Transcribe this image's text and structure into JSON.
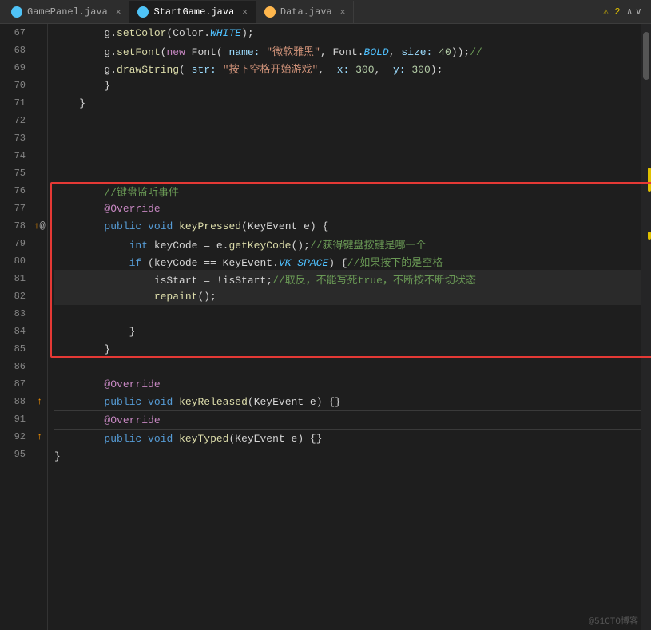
{
  "tabs": [
    {
      "id": "gamepanel",
      "label": "GamePanel.java",
      "active": false,
      "iconColor": "blue"
    },
    {
      "id": "startgame",
      "label": "StartGame.java",
      "active": true,
      "iconColor": "blue"
    },
    {
      "id": "data",
      "label": "Data.java",
      "active": false,
      "iconColor": "orange"
    }
  ],
  "toolbar": {
    "warning_count": "⚠ 2",
    "nav_up": "∧",
    "nav_down": "∨"
  },
  "lines": [
    {
      "num": 67,
      "indent": 2,
      "content": "g.setColor(Color.<span class='const italic'>WHITE</span>);"
    },
    {
      "num": 68,
      "indent": 2,
      "content": "g.setFont(<span class='kw2'>new</span> Font( <span class='param-label'>name:</span> <span class='string'>\"微软雅黑\"</span>, Font.<span class='const italic'>BOLD</span>,  <span class='param-label'>size:</span> <span class='number'>40</span>));<span class='comment'>//</span>"
    },
    {
      "num": 69,
      "indent": 2,
      "content": "g.drawString( <span class='param-label'>str:</span> <span class='string'>\"按下空格开始游戏\"</span>,  <span class='param-label'>x:</span> <span class='number'>300</span>,  <span class='param-label'>y:</span> <span class='number'>300</span>);"
    },
    {
      "num": 70,
      "indent": 2,
      "content": "}"
    },
    {
      "num": 71,
      "indent": 1,
      "content": "}"
    },
    {
      "num": 72,
      "indent": 0,
      "content": ""
    },
    {
      "num": 73,
      "indent": 0,
      "content": ""
    },
    {
      "num": 74,
      "indent": 0,
      "content": ""
    },
    {
      "num": 75,
      "indent": 0,
      "content": ""
    },
    {
      "num": 76,
      "indent": 2,
      "content": "<span class='comment'>//键盘监听事件</span>",
      "redbox": true
    },
    {
      "num": 77,
      "indent": 2,
      "content": "<span class='annotation'>@Override</span>",
      "redbox": true
    },
    {
      "num": 78,
      "indent": 2,
      "content": "<span class='kw'>public</span> <span class='kw'>void</span> <span class='method'>keyPressed</span>(KeyEvent e) {",
      "redbox": true
    },
    {
      "num": 79,
      "indent": 3,
      "content": "<span class='kw'>int</span> keyCode = e.<span class='method'>getKeyCode</span>();<span class='comment'>//获得键盘按键是哪一个</span>",
      "redbox": true
    },
    {
      "num": 80,
      "indent": 3,
      "content": "<span class='kw'>if</span> (keyCode == KeyEvent.<span class='const italic'>VK_SPACE</span>) {<span class='comment'>//如果按下的是空格</span>",
      "redbox": true
    },
    {
      "num": 81,
      "indent": 4,
      "content": "isStart = !isStart;<span class='comment'>//取反，不能写死true，不断按不断切状态</span>",
      "redbox": true,
      "highlighted": true
    },
    {
      "num": 82,
      "indent": 4,
      "content": "<span class='method'>repaint</span>();",
      "redbox": true,
      "highlighted": true
    },
    {
      "num": 83,
      "indent": 0,
      "content": "",
      "redbox": true
    },
    {
      "num": 84,
      "indent": 3,
      "content": "}",
      "redbox": true
    },
    {
      "num": 85,
      "indent": 2,
      "content": "}",
      "redbox": true
    },
    {
      "num": 86,
      "indent": 0,
      "content": ""
    },
    {
      "num": 87,
      "indent": 2,
      "content": "<span class='annotation'>@Override</span>"
    },
    {
      "num": 88,
      "indent": 2,
      "content": "<span class='kw'>public</span> <span class='kw'>void</span> <span class='method'>keyReleased</span>(KeyEvent e) {}"
    },
    {
      "num": 91,
      "indent": 2,
      "content": "<span class='annotation'>@Override</span>"
    },
    {
      "num": 92,
      "indent": 2,
      "content": "<span class='kw'>public</span> <span class='kw'>void</span> <span class='method'>keyTyped</span>(KeyEvent e) {}"
    },
    {
      "num": 95,
      "indent": 0,
      "content": "}"
    }
  ],
  "gutter_icons": {
    "78": {
      "type": "up_arrow",
      "extra": "at"
    },
    "88": {
      "type": "up_arrow"
    },
    "92": {
      "type": "up_arrow"
    }
  },
  "watermark": "@51CTO博客"
}
